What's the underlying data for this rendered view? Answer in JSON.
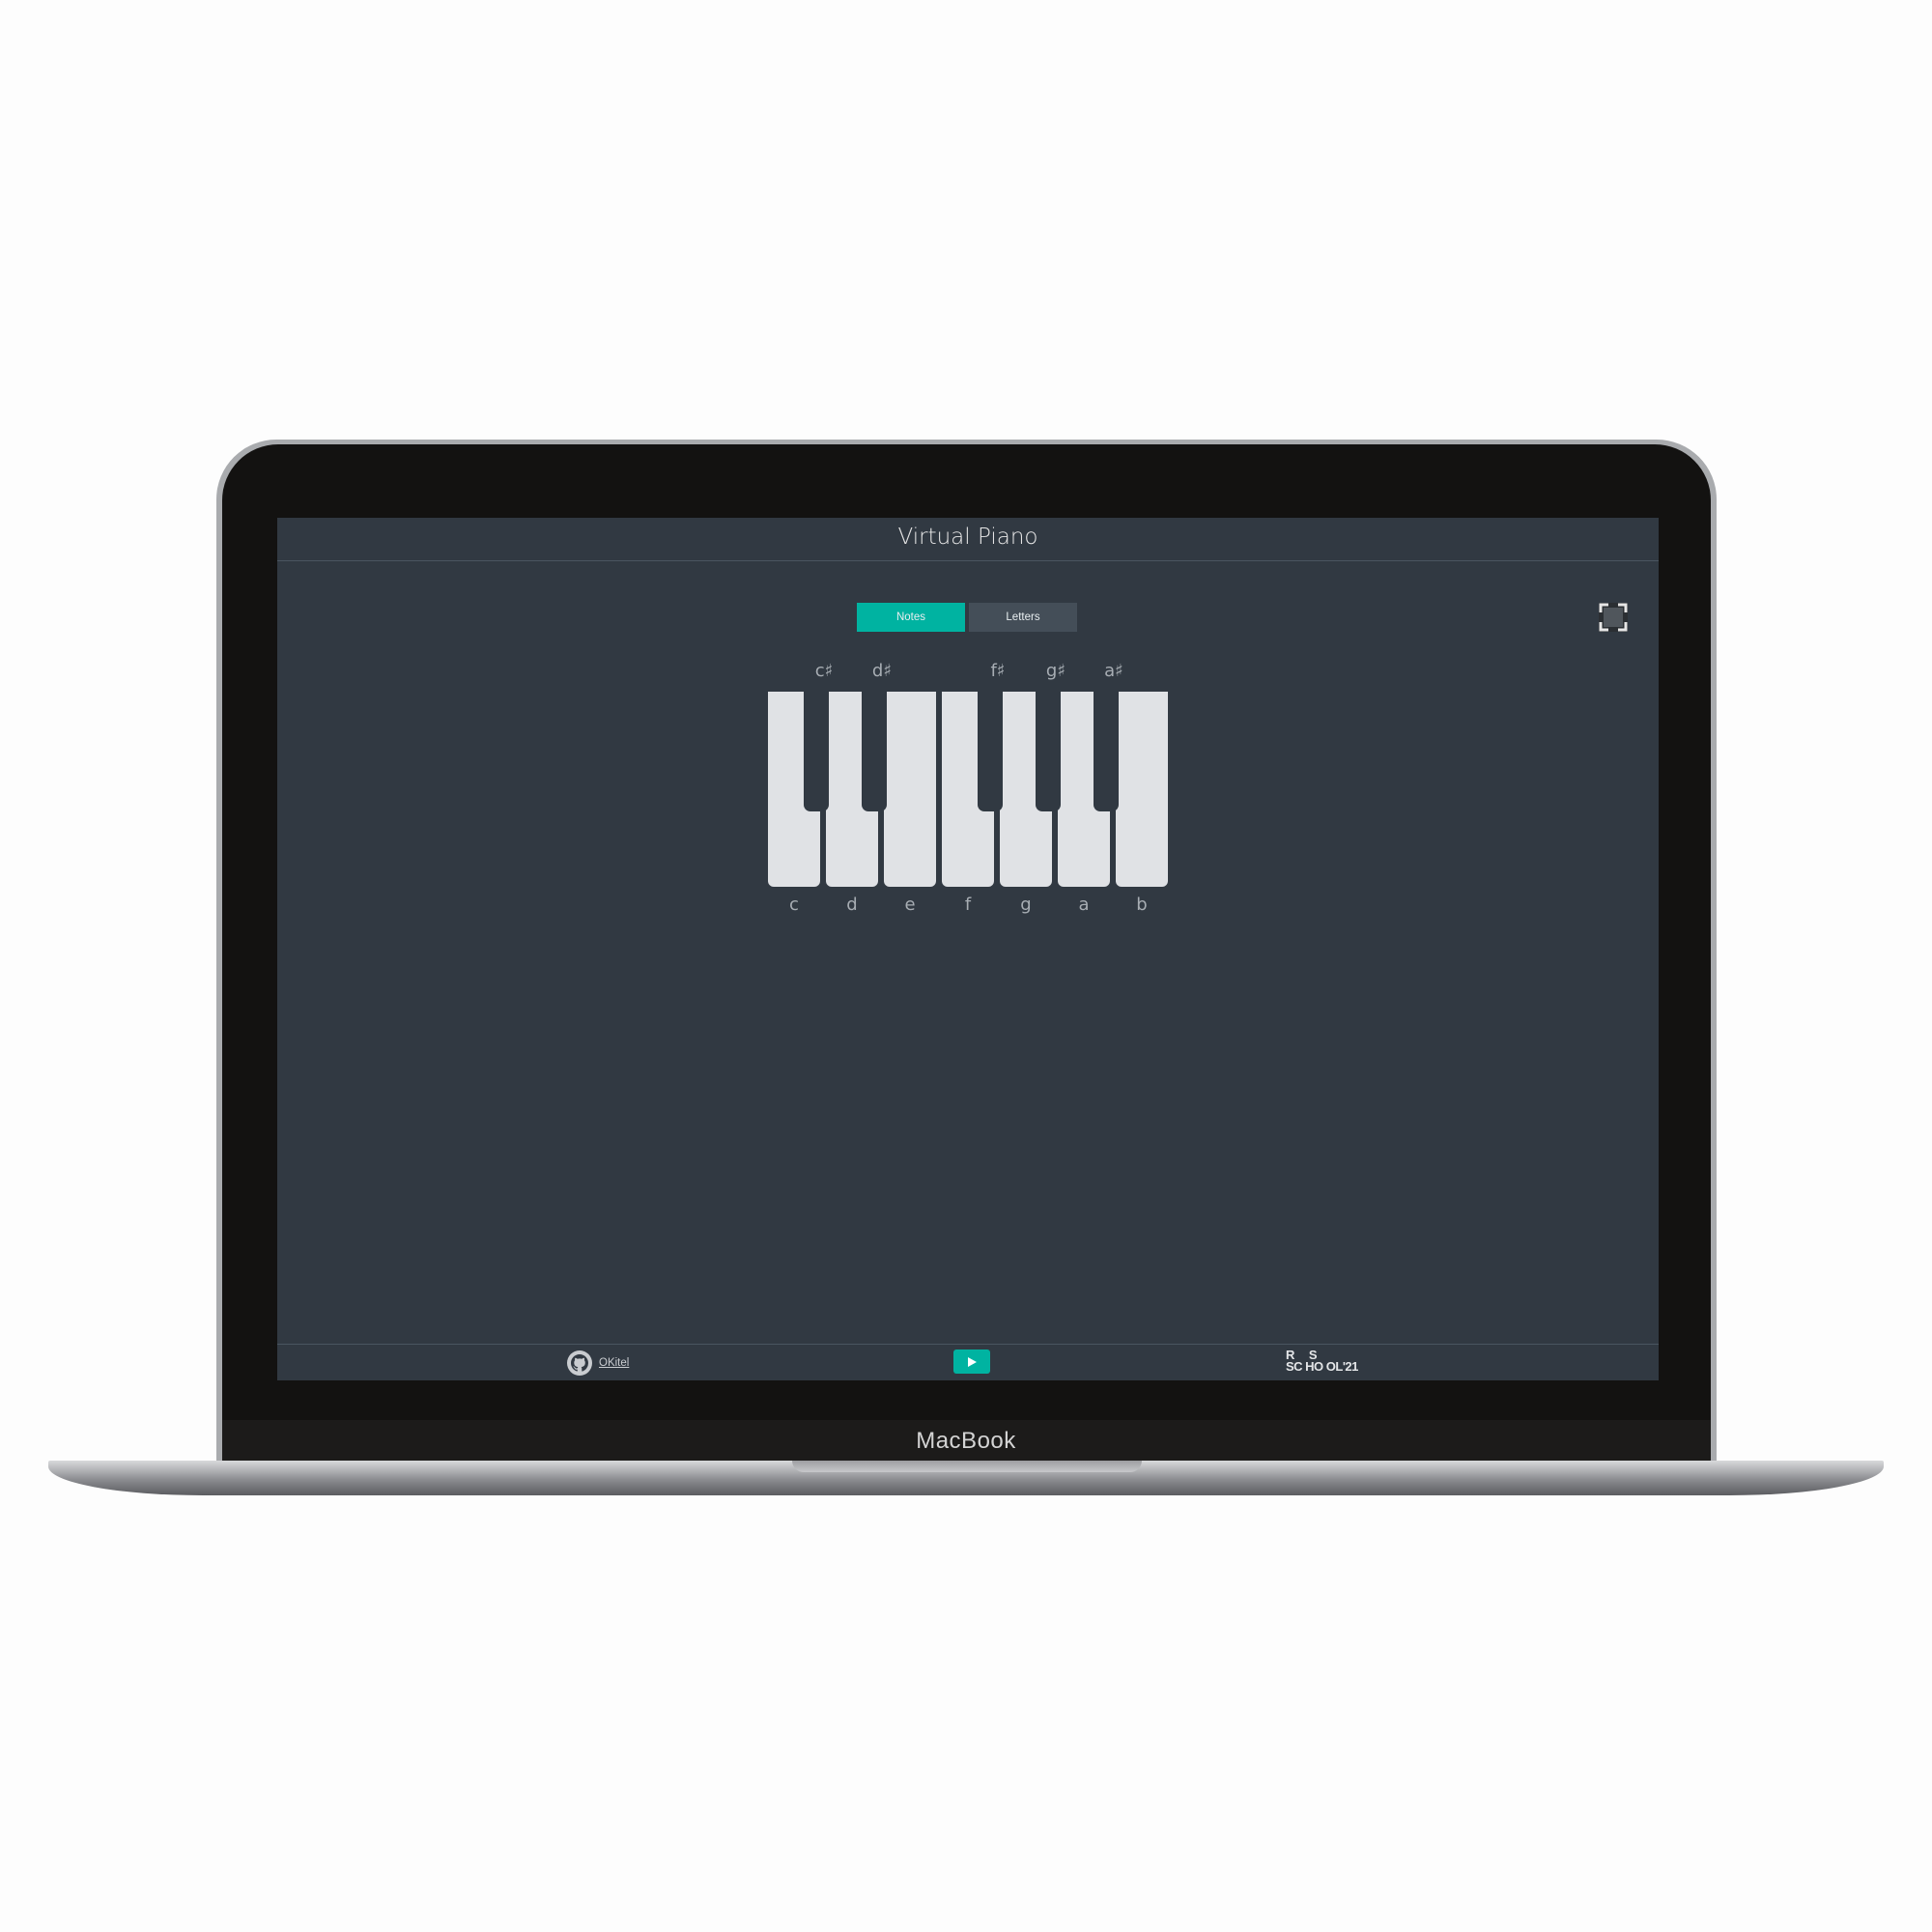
{
  "device": {
    "brand": "MacBook"
  },
  "app": {
    "title": "Virtual Piano",
    "mode_toggle": {
      "notes_label": "Notes",
      "letters_label": "Letters",
      "active": "Notes"
    },
    "fullscreen_icon": "fullscreen-icon"
  },
  "piano": {
    "white_keys": [
      "c",
      "d",
      "e",
      "f",
      "g",
      "a",
      "b"
    ],
    "black_keys": [
      "c♯",
      "d♯",
      "f♯",
      "g♯",
      "a♯"
    ]
  },
  "footer": {
    "github_icon": "github-icon",
    "github_label": "OKitel",
    "play_icon": "play-icon",
    "school_logo_line1": "R    S",
    "school_logo_line2": "SC HO OL'21"
  },
  "colors": {
    "accent": "#00b3a1",
    "screen_bg": "#313942",
    "white_key": "#e0e2e5",
    "label": "#a7adb3"
  }
}
